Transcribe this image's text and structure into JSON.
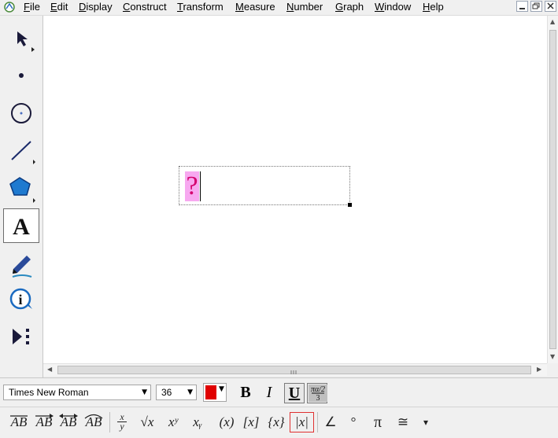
{
  "menu": {
    "items": [
      "File",
      "Edit",
      "Display",
      "Construct",
      "Transform",
      "Measure",
      "Number",
      "Graph",
      "Window",
      "Help"
    ]
  },
  "window_controls": {
    "minimize": "▫",
    "restore": "⧉",
    "close": "✕"
  },
  "tools": [
    {
      "id": "arrow",
      "icon": "selection-arrow-icon"
    },
    {
      "id": "point",
      "icon": "point-icon"
    },
    {
      "id": "compass",
      "icon": "compass-circle-icon"
    },
    {
      "id": "straightedge",
      "icon": "straightedge-icon"
    },
    {
      "id": "polygon",
      "icon": "polygon-icon"
    },
    {
      "id": "text",
      "icon": "text-tool-icon",
      "label": "A",
      "selected": true
    },
    {
      "id": "marker",
      "icon": "marker-pen-icon"
    },
    {
      "id": "information",
      "icon": "information-icon",
      "label": "i"
    },
    {
      "id": "custom",
      "icon": "custom-tool-icon"
    }
  ],
  "canvas": {
    "text_placeholder": "?",
    "text_color": "#d4006c",
    "highlight_color": "#f7a8f0"
  },
  "text_toolbar": {
    "font_name": "Times New Roman",
    "font_size": "36",
    "text_color": "#e00000",
    "bold_label": "B",
    "italic_label": "I",
    "underline_label": "U",
    "math_format_icon": "math-format-icon",
    "math_format_label": "πα/2 / 3"
  },
  "symbols": {
    "segment": "AB",
    "ray": "AB",
    "line": "AB",
    "arc": "AB",
    "fraction_num": "x",
    "fraction_den": "y",
    "sqrt": "√x",
    "power": "xʸ",
    "subscript": "xᵧ",
    "parens": "(x)",
    "brackets": "[x]",
    "braces": "{x}",
    "abs": "|x|",
    "angle": "∠",
    "degree": "°",
    "pi": "π",
    "congruent": "≅",
    "more": "▾"
  }
}
